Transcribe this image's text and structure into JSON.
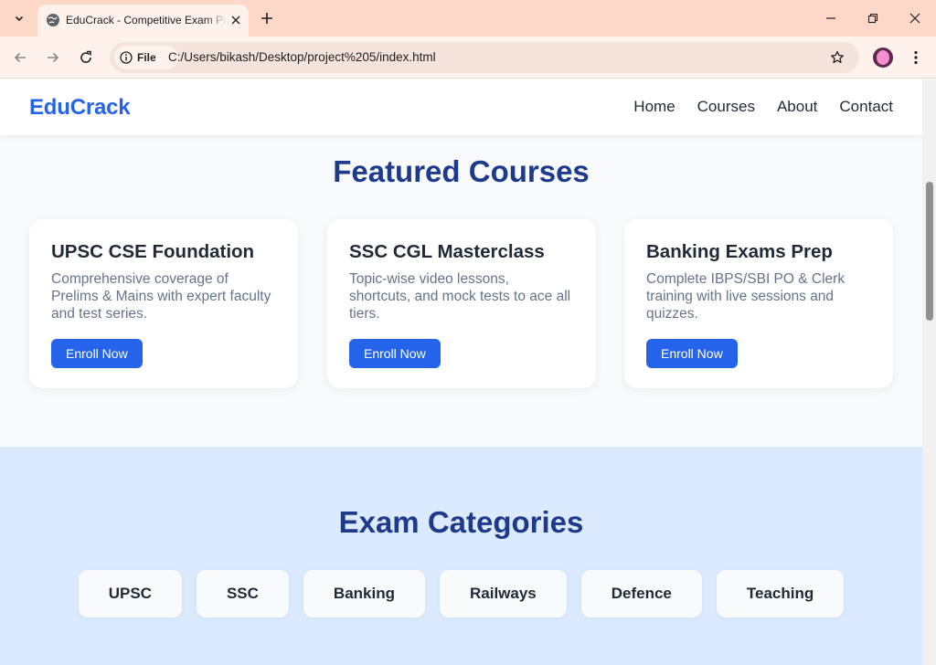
{
  "browser": {
    "tab_title": "EduCrack - Competitive Exam Preparation",
    "url": "C:/Users/bikash/Desktop/project%205/index.html",
    "site_chip_label": "File"
  },
  "site": {
    "brand": "EduCrack",
    "nav": [
      "Home",
      "Courses",
      "About",
      "Contact"
    ]
  },
  "featured": {
    "title": "Featured Courses",
    "cards": [
      {
        "title": "UPSC CSE Foundation",
        "desc": "Comprehensive coverage of Prelims & Mains with expert faculty and test series.",
        "button": "Enroll Now"
      },
      {
        "title": "SSC CGL Masterclass",
        "desc": "Topic-wise video lessons, shortcuts, and mock tests to ace all tiers.",
        "button": "Enroll Now"
      },
      {
        "title": "Banking Exams Prep",
        "desc": "Complete IBPS/SBI PO & Clerk training with live sessions and quizzes.",
        "button": "Enroll Now"
      }
    ]
  },
  "categories": {
    "title": "Exam Categories",
    "items": [
      "UPSC",
      "SSC",
      "Banking",
      "Railways",
      "Defence",
      "Teaching"
    ]
  },
  "colors": {
    "brand": "#2563eb",
    "heading": "#1e3a8a",
    "categories_bg": "#dbeafe",
    "tabbar_bg": "#fdd7c8"
  }
}
